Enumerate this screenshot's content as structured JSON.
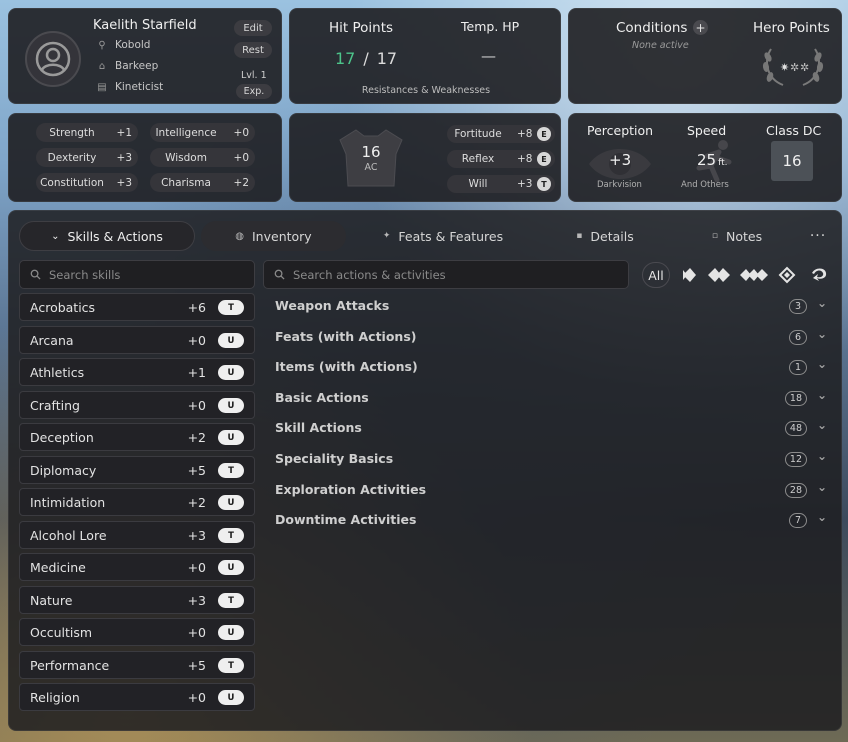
{
  "profile": {
    "name": "Kaelith Starfield",
    "ancestry": "Kobold",
    "background": "Barkeep",
    "class": "Kineticist",
    "edit_label": "Edit",
    "rest_label": "Rest",
    "level": "Lvl. 1",
    "exp_label": "Exp."
  },
  "hp": {
    "title": "Hit Points",
    "current": "17",
    "separator": "/",
    "max": "17",
    "temp_title": "Temp. HP",
    "temp_value": "—",
    "resistances_label": "Resistances & Weaknesses",
    "current_color": "#4cc38a"
  },
  "conditions": {
    "title": "Conditions",
    "add": "+",
    "none_label": "None active",
    "hero_title": "Hero Points"
  },
  "attributes": [
    {
      "name": "Strength",
      "value": "+1"
    },
    {
      "name": "Intelligence",
      "value": "+0"
    },
    {
      "name": "Dexterity",
      "value": "+3"
    },
    {
      "name": "Wisdom",
      "value": "+0"
    },
    {
      "name": "Constitution",
      "value": "+3"
    },
    {
      "name": "Charisma",
      "value": "+2"
    }
  ],
  "defense": {
    "ac_value": "16",
    "ac_label": "AC",
    "saves": [
      {
        "name": "Fortitude",
        "value": "+8",
        "rank": "E"
      },
      {
        "name": "Reflex",
        "value": "+8",
        "rank": "E"
      },
      {
        "name": "Will",
        "value": "+3",
        "rank": "T"
      }
    ]
  },
  "perception": {
    "title": "Perception",
    "value": "+3",
    "sense": "Darkvision",
    "speed_title": "Speed",
    "speed_value": "25",
    "speed_unit": "ft.",
    "speed_note": "And Others",
    "classdc_title": "Class DC",
    "classdc_value": "16"
  },
  "tabs": [
    {
      "label": "Skills & Actions"
    },
    {
      "label": "Inventory"
    },
    {
      "label": "Feats & Features"
    },
    {
      "label": "Details"
    },
    {
      "label": "Notes"
    }
  ],
  "more_label": "···",
  "skills_search_placeholder": "Search skills",
  "actions_search_placeholder": "Search actions & activities",
  "filter_all": "All",
  "skills": [
    {
      "name": "Acrobatics",
      "mod": "+6",
      "rank": "T"
    },
    {
      "name": "Arcana",
      "mod": "+0",
      "rank": "U"
    },
    {
      "name": "Athletics",
      "mod": "+1",
      "rank": "U"
    },
    {
      "name": "Crafting",
      "mod": "+0",
      "rank": "U"
    },
    {
      "name": "Deception",
      "mod": "+2",
      "rank": "U"
    },
    {
      "name": "Diplomacy",
      "mod": "+5",
      "rank": "T"
    },
    {
      "name": "Intimidation",
      "mod": "+2",
      "rank": "U"
    },
    {
      "name": "Alcohol Lore",
      "mod": "+3",
      "rank": "T"
    },
    {
      "name": "Medicine",
      "mod": "+0",
      "rank": "U"
    },
    {
      "name": "Nature",
      "mod": "+3",
      "rank": "T"
    },
    {
      "name": "Occultism",
      "mod": "+0",
      "rank": "U"
    },
    {
      "name": "Performance",
      "mod": "+5",
      "rank": "T"
    },
    {
      "name": "Religion",
      "mod": "+0",
      "rank": "U"
    }
  ],
  "categories": [
    {
      "name": "Weapon Attacks",
      "count": "3"
    },
    {
      "name": "Feats (with Actions)",
      "count": "6"
    },
    {
      "name": "Items (with Actions)",
      "count": "1"
    },
    {
      "name": "Basic Actions",
      "count": "18"
    },
    {
      "name": "Skill Actions",
      "count": "48"
    },
    {
      "name": "Speciality Basics",
      "count": "12"
    },
    {
      "name": "Exploration Activities",
      "count": "28"
    },
    {
      "name": "Downtime Activities",
      "count": "7"
    }
  ]
}
